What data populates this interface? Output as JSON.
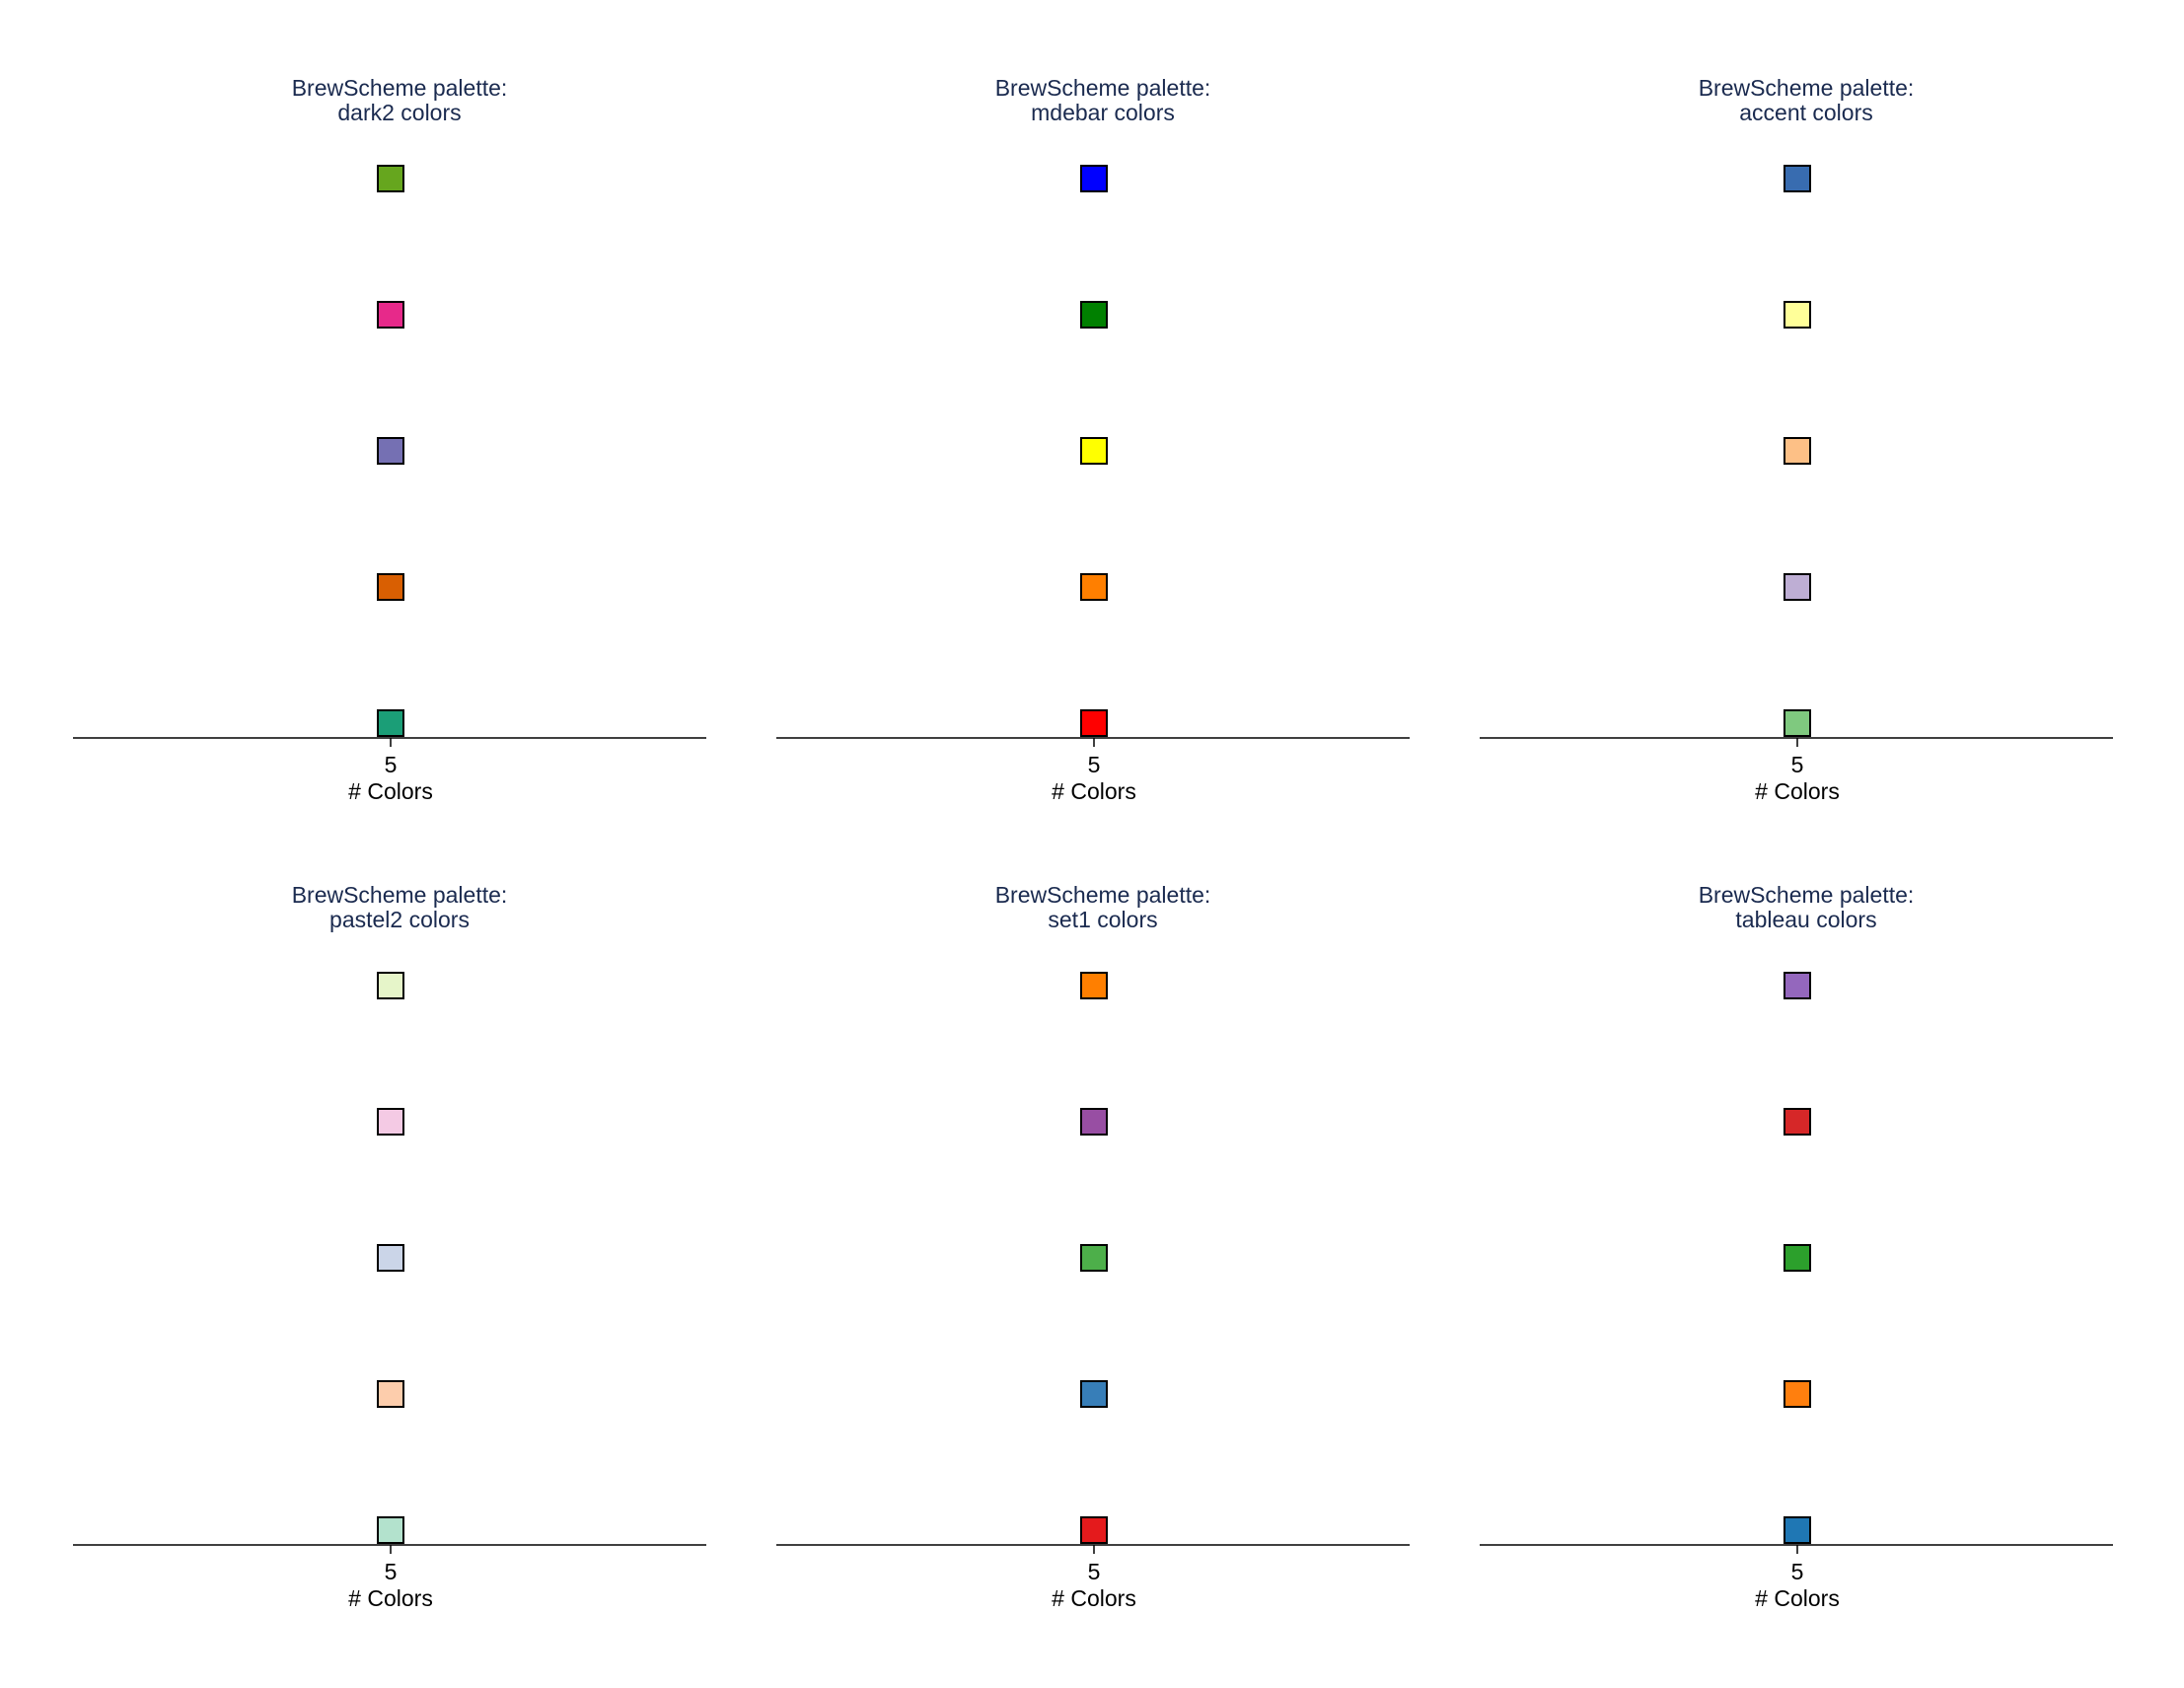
{
  "chart_data": [
    {
      "type": "scatter",
      "title": [
        "BrewScheme palette:",
        "dark2 colors"
      ],
      "xlabel": "# Colors",
      "x_ticks": [
        "5"
      ],
      "x": [
        5,
        5,
        5,
        5,
        5
      ],
      "y": [
        1,
        2,
        3,
        4,
        5
      ],
      "colors": [
        "#1b9e77",
        "#d95f02",
        "#7570b3",
        "#e7298a",
        "#66a61e"
      ]
    },
    {
      "type": "scatter",
      "title": [
        "BrewScheme palette:",
        "mdebar colors"
      ],
      "xlabel": "# Colors",
      "x_ticks": [
        "5"
      ],
      "x": [
        5,
        5,
        5,
        5,
        5
      ],
      "y": [
        1,
        2,
        3,
        4,
        5
      ],
      "colors": [
        "#ff0000",
        "#ff7f00",
        "#ffff00",
        "#008000",
        "#0000ff"
      ]
    },
    {
      "type": "scatter",
      "title": [
        "BrewScheme palette:",
        "accent colors"
      ],
      "xlabel": "# Colors",
      "x_ticks": [
        "5"
      ],
      "x": [
        5,
        5,
        5,
        5,
        5
      ],
      "y": [
        1,
        2,
        3,
        4,
        5
      ],
      "colors": [
        "#7fc97f",
        "#beaed4",
        "#fdc086",
        "#ffff99",
        "#386cb0"
      ]
    },
    {
      "type": "scatter",
      "title": [
        "BrewScheme palette:",
        "pastel2 colors"
      ],
      "xlabel": "# Colors",
      "x_ticks": [
        "5"
      ],
      "x": [
        5,
        5,
        5,
        5,
        5
      ],
      "y": [
        1,
        2,
        3,
        4,
        5
      ],
      "colors": [
        "#b3e2cd",
        "#fdcdac",
        "#cbd5e8",
        "#f4cae4",
        "#e6f5c9"
      ]
    },
    {
      "type": "scatter",
      "title": [
        "BrewScheme palette:",
        "set1 colors"
      ],
      "xlabel": "# Colors",
      "x_ticks": [
        "5"
      ],
      "x": [
        5,
        5,
        5,
        5,
        5
      ],
      "y": [
        1,
        2,
        3,
        4,
        5
      ],
      "colors": [
        "#e41a1c",
        "#377eb8",
        "#4daf4a",
        "#984ea3",
        "#ff7f00"
      ]
    },
    {
      "type": "scatter",
      "title": [
        "BrewScheme palette:",
        "tableau colors"
      ],
      "xlabel": "# Colors",
      "x_ticks": [
        "5"
      ],
      "x": [
        5,
        5,
        5,
        5,
        5
      ],
      "y": [
        1,
        2,
        3,
        4,
        5
      ],
      "colors": [
        "#1f77b4",
        "#ff7f0e",
        "#2ca02c",
        "#d62728",
        "#9467bd"
      ]
    }
  ]
}
